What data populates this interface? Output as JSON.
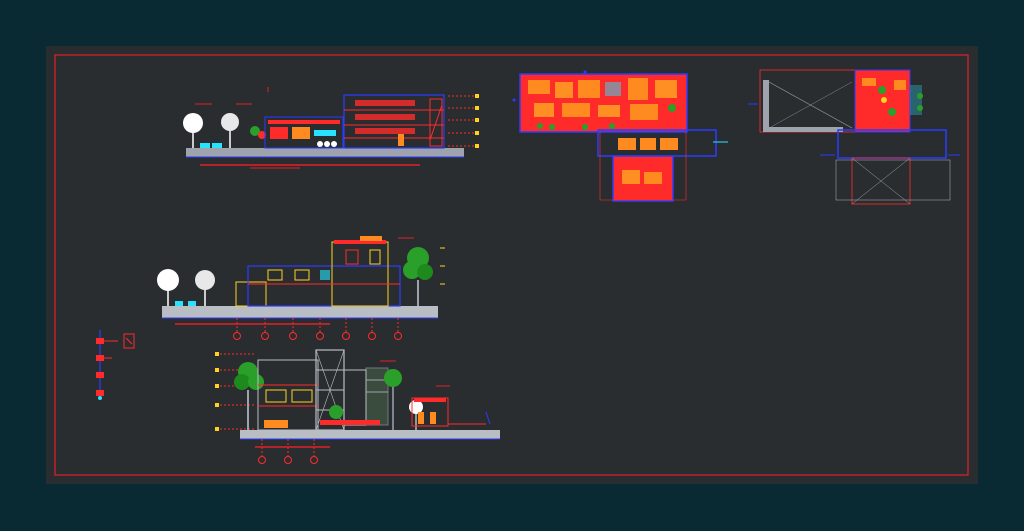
{
  "viewport": {
    "background_color": "#0a2a33",
    "modelspace_color": "#2a2d30",
    "frame_color": "#e0202a"
  },
  "layer_colors": {
    "walls_red": "#ff2a2a",
    "outline_blue": "#2a3cff",
    "ground_gray": "#9ea3ad",
    "trees_green": "#2aa02a",
    "trees_white": "#ffffff",
    "annotations_yellow": "#ffd21f",
    "glass_cyan": "#29e2ff",
    "furniture_orange": "#ff8a1f",
    "structure_light": "#b9bdc4"
  },
  "sheets": [
    "section-1",
    "floor-plan-1",
    "roof-plan",
    "elevation-1",
    "detail-small",
    "elevation-2"
  ]
}
